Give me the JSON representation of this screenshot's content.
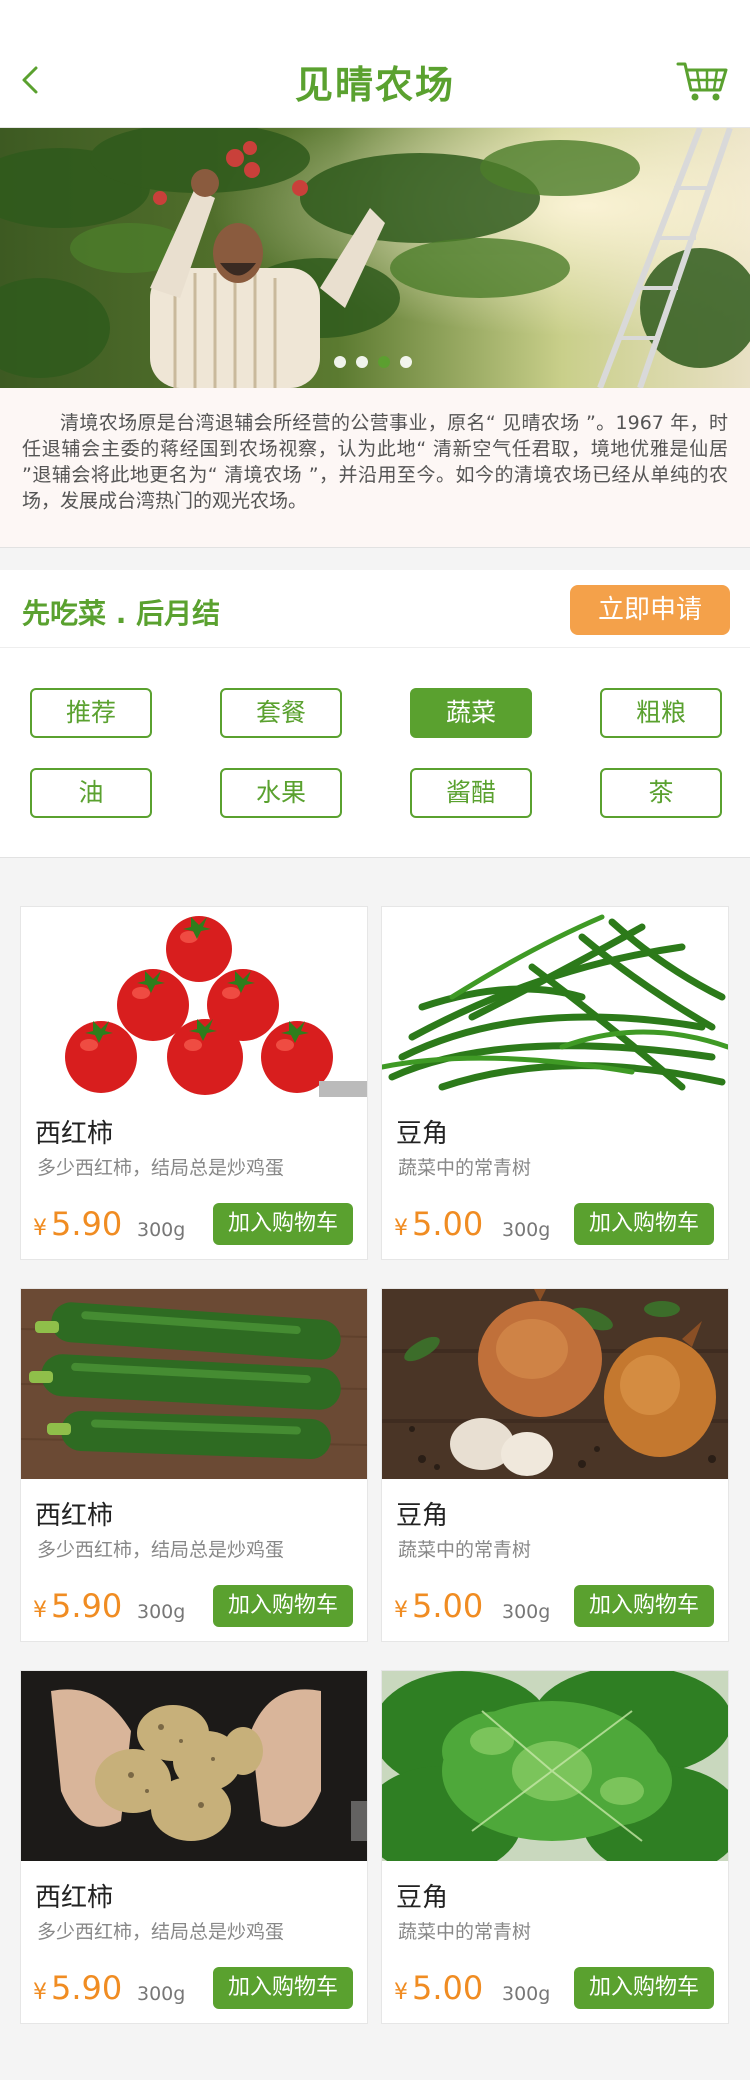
{
  "header": {
    "title": "见晴农场",
    "back_icon": "chevron-left-icon",
    "cart_icon": "cart-icon"
  },
  "banner": {
    "slides": 4,
    "active_slide": 3
  },
  "intro": {
    "text": "清境农场原是台湾退辅会所经营的公营事业，原名“ 见晴农场 ”。1967 年，时任退辅会主委的蒋经国到农场视察，认为此地“ 清新空气任君取，境地优雅是仙居 ”退辅会将此地更名为“ 清境农场 ”，并沿用至今。如今的清境农场已经从单纯的农场，发展成台湾热门的观光农场。"
  },
  "promo": {
    "text": "先吃菜 . 后月结",
    "apply_label": "立即申请"
  },
  "categories": [
    {
      "label": "推荐",
      "active": false
    },
    {
      "label": "套餐",
      "active": false
    },
    {
      "label": "蔬菜",
      "active": true
    },
    {
      "label": "粗粮",
      "active": false
    },
    {
      "label": "油",
      "active": false
    },
    {
      "label": "水果",
      "active": false
    },
    {
      "label": "酱醋",
      "active": false
    },
    {
      "label": "茶",
      "active": false
    }
  ],
  "products": [
    {
      "name": "西红柿",
      "desc": "多少西红柿，结局总是炒鸡蛋",
      "currency": "¥",
      "price": "5.90",
      "weight": "300g",
      "add_label": "加入购物车",
      "image": "tomatoes"
    },
    {
      "name": "豆角",
      "desc": "蔬菜中的常青树",
      "currency": "¥",
      "price": "5.00",
      "weight": "300g",
      "add_label": "加入购物车",
      "image": "green-beans"
    },
    {
      "name": "西红柿",
      "desc": "多少西红柿，结局总是炒鸡蛋",
      "currency": "¥",
      "price": "5.90",
      "weight": "300g",
      "add_label": "加入购物车",
      "image": "zucchini"
    },
    {
      "name": "豆角",
      "desc": "蔬菜中的常青树",
      "currency": "¥",
      "price": "5.00",
      "weight": "300g",
      "add_label": "加入购物车",
      "image": "onions"
    },
    {
      "name": "西红柿",
      "desc": "多少西红柿，结局总是炒鸡蛋",
      "currency": "¥",
      "price": "5.90",
      "weight": "300g",
      "add_label": "加入购物车",
      "image": "potatoes"
    },
    {
      "name": "豆角",
      "desc": "蔬菜中的常青树",
      "currency": "¥",
      "price": "5.00",
      "weight": "300g",
      "add_label": "加入购物车",
      "image": "lettuce"
    }
  ],
  "colors": {
    "brand_green": "#5aa12f",
    "accent_orange": "#f4a14a",
    "price_orange": "#f08c22"
  }
}
